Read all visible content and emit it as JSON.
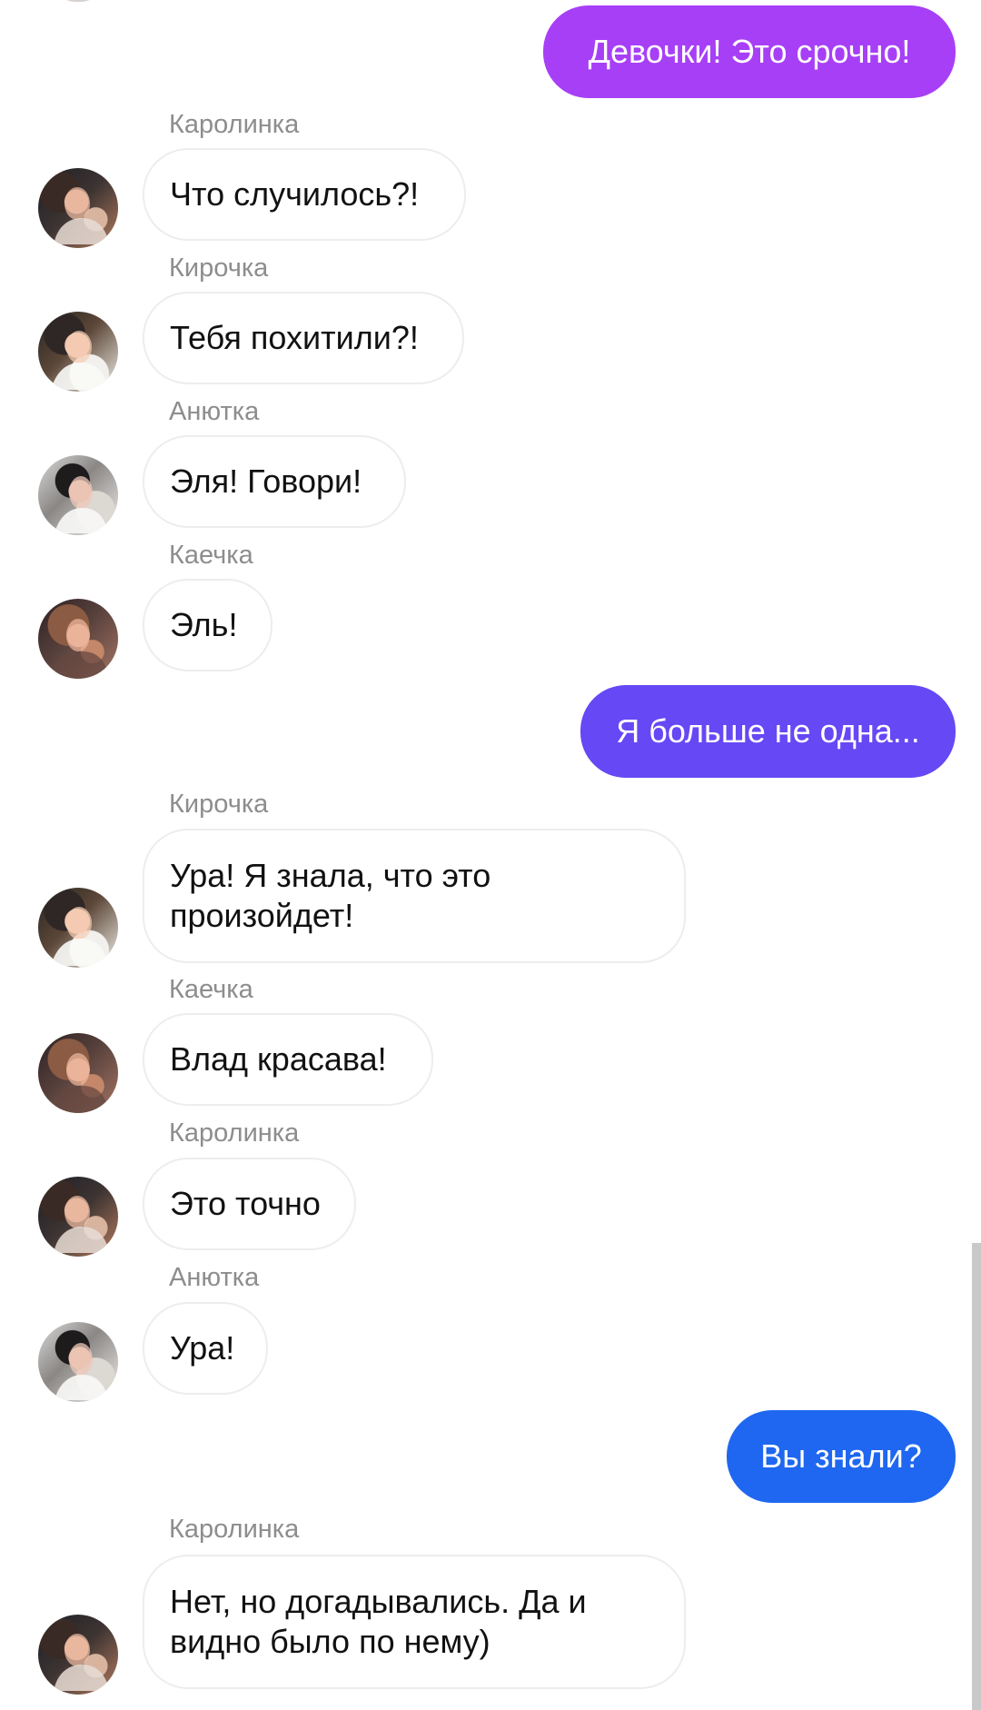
{
  "colors": {
    "outgoing_1": "#a73ff7",
    "outgoing_2": "#6648f5",
    "outgoing_3": "#1f67f0",
    "incoming_bg": "#ffffff",
    "incoming_border": "#ededed",
    "sender_name": "#8d8d8d",
    "scrollbar": "#c9c9c9"
  },
  "messages": [
    {
      "type": "outgoing",
      "text": "Девочки! Это срочно!"
    },
    {
      "type": "incoming",
      "sender": "Каролинка",
      "avatar": "karolinka-avatar-icon",
      "text": "Что случилось?!"
    },
    {
      "type": "incoming",
      "sender": "Кирочка",
      "avatar": "kirochka-avatar-icon",
      "text": "Тебя похитили?!"
    },
    {
      "type": "incoming",
      "sender": "Анютка",
      "avatar": "anyutka-avatar-icon",
      "text": "Эля! Говори!"
    },
    {
      "type": "incoming",
      "sender": "Каечка",
      "avatar": "kaechka-avatar-icon",
      "text": "Эль!"
    },
    {
      "type": "outgoing",
      "text": "Я больше не одна..."
    },
    {
      "type": "incoming",
      "sender": "Кирочка",
      "avatar": "kirochka-avatar-icon",
      "text_lines": [
        "Ура! Я знала, что это",
        "произойдет!"
      ]
    },
    {
      "type": "incoming",
      "sender": "Каечка",
      "avatar": "kaechka-avatar-icon",
      "text": "Влад красава!"
    },
    {
      "type": "incoming",
      "sender": "Каролинка",
      "avatar": "karolinka-avatar-icon",
      "text": "Это точно"
    },
    {
      "type": "incoming",
      "sender": "Анютка",
      "avatar": "anyutka-avatar-icon",
      "text": "Ура!"
    },
    {
      "type": "outgoing",
      "text": "Вы знали?"
    },
    {
      "type": "incoming",
      "sender": "Каролинка",
      "avatar": "karolinka-avatar-icon",
      "text_lines": [
        "Нет, но догадывались. Да и",
        "видно было по нему)"
      ]
    }
  ]
}
